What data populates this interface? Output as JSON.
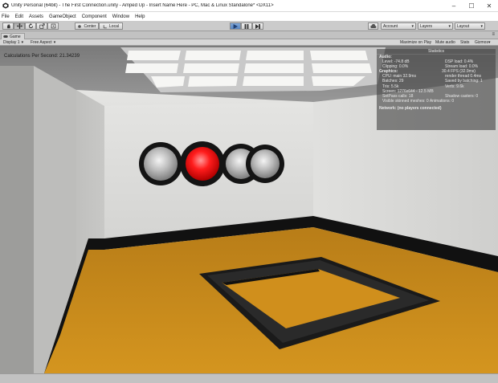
{
  "window": {
    "title": "Unity Personal (64bit) - The First Connection.unity - Amped Up - Insert Name Here - PC, Mac & Linux Standalone* <DX11>",
    "minimize": "–",
    "maximize": "☐",
    "close": "✕"
  },
  "menu": [
    "File",
    "Edit",
    "Assets",
    "GameObject",
    "Component",
    "Window",
    "Help"
  ],
  "toolbar": {
    "pivot_label": "Center",
    "space_label": "Local",
    "account_label": "Account",
    "layers_label": "Layers",
    "layout_label": "Layout"
  },
  "tabs": {
    "game": "Game"
  },
  "game_toolbar": {
    "display": "Display 1",
    "aspect": "Free Aspect",
    "maximize_on_play": "Maximize on Play",
    "mute_audio": "Mute audio",
    "stats": "Stats",
    "gizmos": "Gizmos"
  },
  "overlay": {
    "calc_text": "Calculations Per Second: 21.34239"
  },
  "stats_panel": {
    "title": "Statistics",
    "audio_heading": "Audio:",
    "audio_rows": [
      [
        "Level: -74.8 dB",
        "DSP load: 0.4%"
      ],
      [
        "Clipping: 0.0%",
        "Stream load: 0.0%"
      ]
    ],
    "graphics_heading": "Graphics:",
    "fps": "30.4 FPS (32.9ms)",
    "graphics_rows": [
      [
        "CPU: main 32.9ms",
        "render thread 0.4ms"
      ],
      [
        "Batches: 29",
        "Saved by batching: 1"
      ],
      [
        "Tris: 5.5k",
        "Verts: 9.6k"
      ],
      [
        "Screen: 1276x644 - 12.5 MB",
        ""
      ],
      [
        "SetPass calls: 18",
        "Shadow casters: 0"
      ]
    ],
    "graphics_footer": "Visible skinned meshes: 0  Animations: 0",
    "network": "Network: (no players connected)"
  },
  "colors": {
    "floor": "#c68a1e",
    "red_light": "#ff1c1c",
    "wall": "#d8d8d6"
  }
}
